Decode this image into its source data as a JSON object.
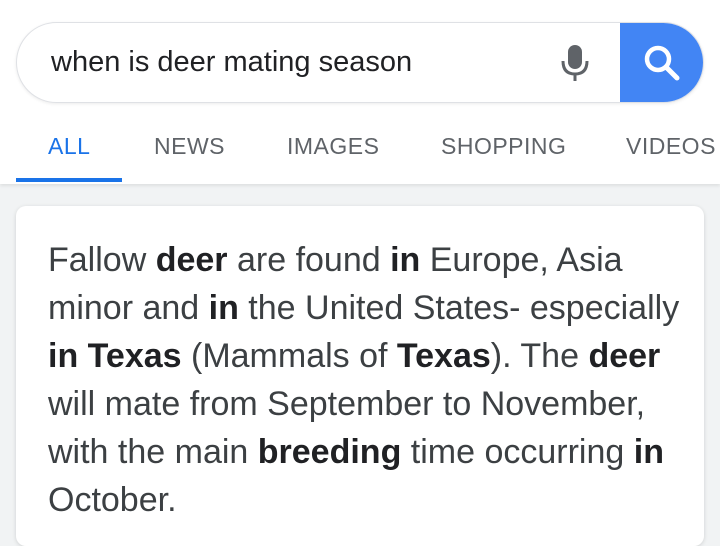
{
  "search": {
    "query": "when is deer mating season"
  },
  "tabs": [
    {
      "label": "ALL",
      "active": true
    },
    {
      "label": "NEWS",
      "active": false
    },
    {
      "label": "IMAGES",
      "active": false
    },
    {
      "label": "SHOPPING",
      "active": false
    },
    {
      "label": "VIDEOS",
      "active": false
    }
  ],
  "colors": {
    "accent": "#1a73e8",
    "search_button": "#4285f4"
  },
  "icons": {
    "mic": "microphone-icon",
    "search": "magnifier-icon"
  },
  "snippet": {
    "parts": [
      {
        "text": "Fallow ",
        "bold": false
      },
      {
        "text": "deer",
        "bold": true
      },
      {
        "text": " are found ",
        "bold": false
      },
      {
        "text": "in",
        "bold": true
      },
      {
        "text": " Europe, Asia minor and ",
        "bold": false
      },
      {
        "text": "in",
        "bold": true
      },
      {
        "text": " the United States- especially ",
        "bold": false
      },
      {
        "text": "in Texas",
        "bold": true
      },
      {
        "text": " (Mammals of ",
        "bold": false
      },
      {
        "text": "Texas",
        "bold": true
      },
      {
        "text": "). The ",
        "bold": false
      },
      {
        "text": "deer",
        "bold": true
      },
      {
        "text": " will mate from September to November, with the main ",
        "bold": false
      },
      {
        "text": "breeding",
        "bold": true
      },
      {
        "text": " time occurring ",
        "bold": false
      },
      {
        "text": "in",
        "bold": true
      },
      {
        "text": " October.",
        "bold": false
      }
    ]
  }
}
